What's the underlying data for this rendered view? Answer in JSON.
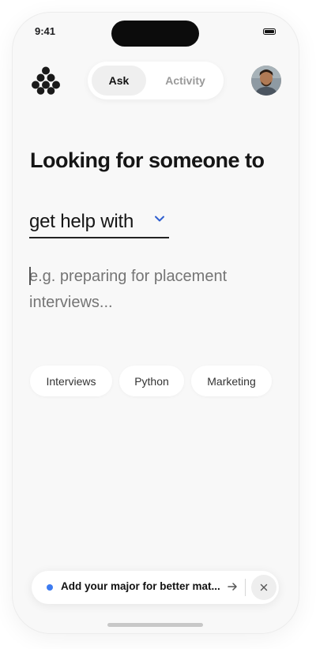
{
  "status_bar": {
    "time": "9:41"
  },
  "header": {
    "tabs": [
      {
        "label": "Ask",
        "selected": true
      },
      {
        "label": "Activity",
        "selected": false
      }
    ]
  },
  "main": {
    "headline": "Looking for someone to",
    "topic_value": "get help with",
    "query_placeholder": "e.g. preparing for placement interviews...",
    "suggestions": [
      "Interviews",
      "Python",
      "Marketing"
    ]
  },
  "banner": {
    "text": "Add your major for better mat...",
    "accent_color": "#3d7bf0",
    "icons": [
      "arrow-right-icon",
      "close-icon"
    ]
  },
  "colors": {
    "accent": "#3d7bf0",
    "background": "#f8f8f8"
  }
}
